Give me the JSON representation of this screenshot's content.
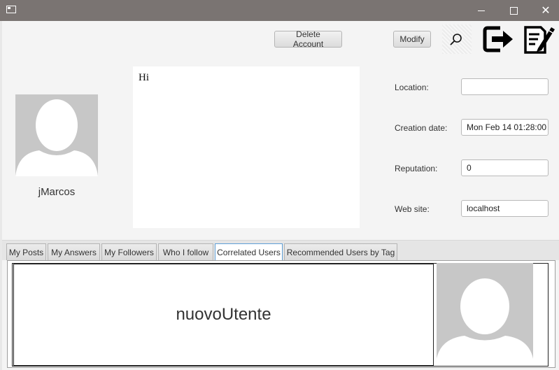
{
  "window": {
    "minimize_glyph": "",
    "maximize_glyph": "",
    "close_glyph": "✕"
  },
  "toolbar": {
    "delete_account_label": "Delete Account",
    "modify_label": "Modify"
  },
  "profile": {
    "username": "jMarcos",
    "bio": "Hi"
  },
  "fields": {
    "location": {
      "label": "Location:",
      "value": ""
    },
    "creation_date": {
      "label": "Creation date:",
      "value": "Mon Feb 14 01:28:00"
    },
    "reputation": {
      "label": "Reputation:",
      "value": "0"
    },
    "web_site": {
      "label": "Web site:",
      "value": "localhost"
    }
  },
  "tabs": [
    {
      "label": "My Posts"
    },
    {
      "label": "My Answers"
    },
    {
      "label": "My Followers"
    },
    {
      "label": "Who I follow"
    },
    {
      "label": "Correlated Users",
      "selected": true
    },
    {
      "label": "Recommended Users by Tag"
    }
  ],
  "correlated_users": [
    {
      "username": "nuovoUtente"
    }
  ],
  "colors": {
    "titlebar": "#7a7472",
    "avatar_bg": "#c7c7c7",
    "tab_selected_border": "#5f9fd6"
  },
  "icons": [
    "app-icon",
    "search-icon",
    "logout-icon",
    "edit-icon",
    "avatar-icon"
  ]
}
